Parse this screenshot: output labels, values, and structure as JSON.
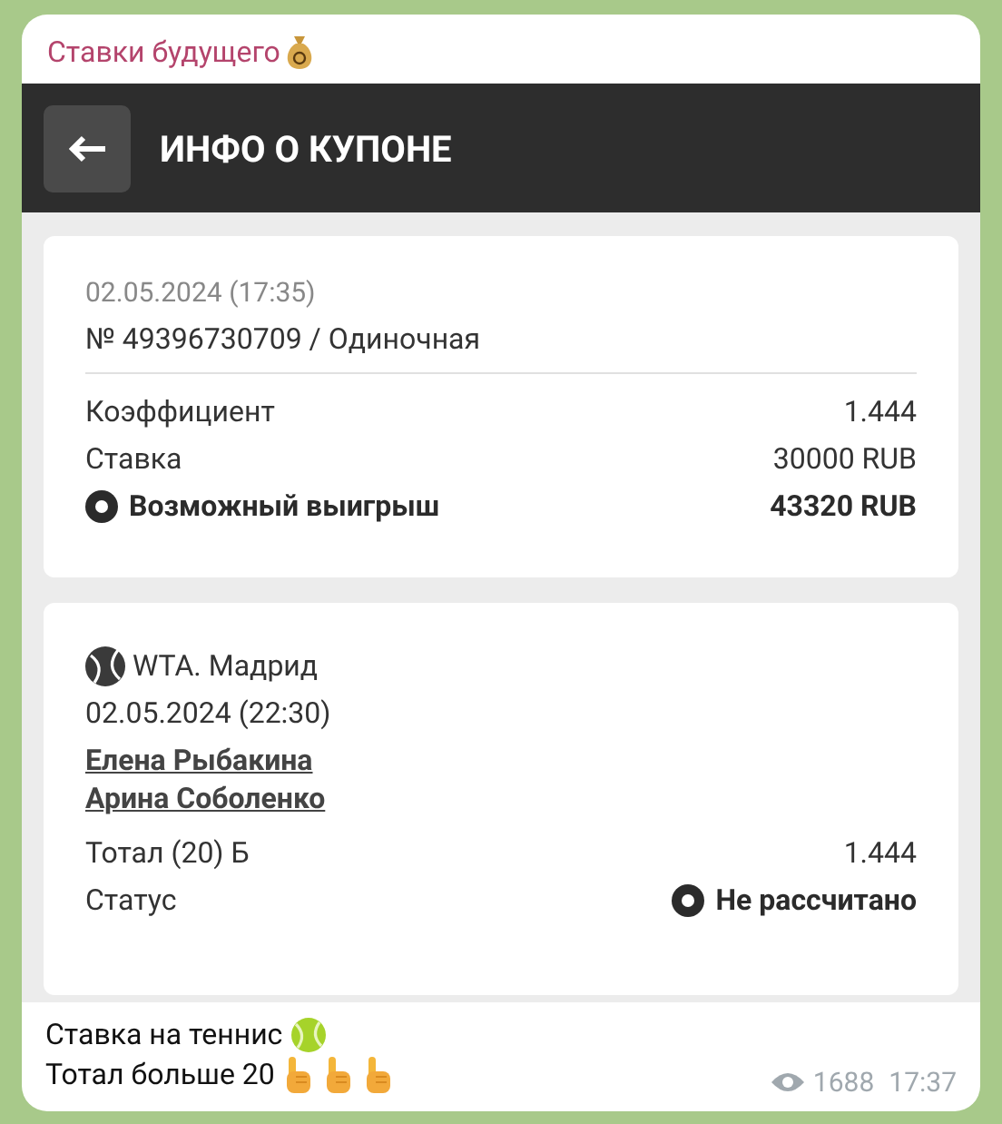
{
  "channel": {
    "name": "Ставки будущего"
  },
  "coupon_screen": {
    "title": "ИНФО О КУПОНЕ",
    "summary": {
      "date": "02.05.2024 (17:35)",
      "number": "№ 49396730709 / Одиночная",
      "rows": [
        {
          "kind": "plain",
          "label": "Коэффициент",
          "value": "1.444"
        },
        {
          "kind": "plain",
          "label": "Ставка",
          "value": "30000 RUB"
        },
        {
          "kind": "highlight",
          "label": "Возможный выигрыш",
          "value": "43320 RUB"
        }
      ]
    },
    "event": {
      "league": "WTA. Мадрид",
      "date": "02.05.2024 (22:30)",
      "players": [
        "Елена Рыбакина",
        "Арина Соболенко"
      ],
      "rows": [
        {
          "kind": "plain",
          "label": "Тотал (20) Б",
          "value": "1.444"
        },
        {
          "kind": "status",
          "label": "Статус",
          "value": "Не рассчитано"
        }
      ]
    }
  },
  "caption": {
    "lines": [
      {
        "text": "Ставка на теннис",
        "icons": [
          {
            "kind": "tennis_ball"
          }
        ]
      },
      {
        "text": "Тотал больше 20",
        "icons": [
          {
            "kind": "pointing_up"
          },
          {
            "kind": "pointing_up"
          },
          {
            "kind": "pointing_up"
          }
        ]
      }
    ]
  },
  "views": "1688",
  "time": "17:37"
}
